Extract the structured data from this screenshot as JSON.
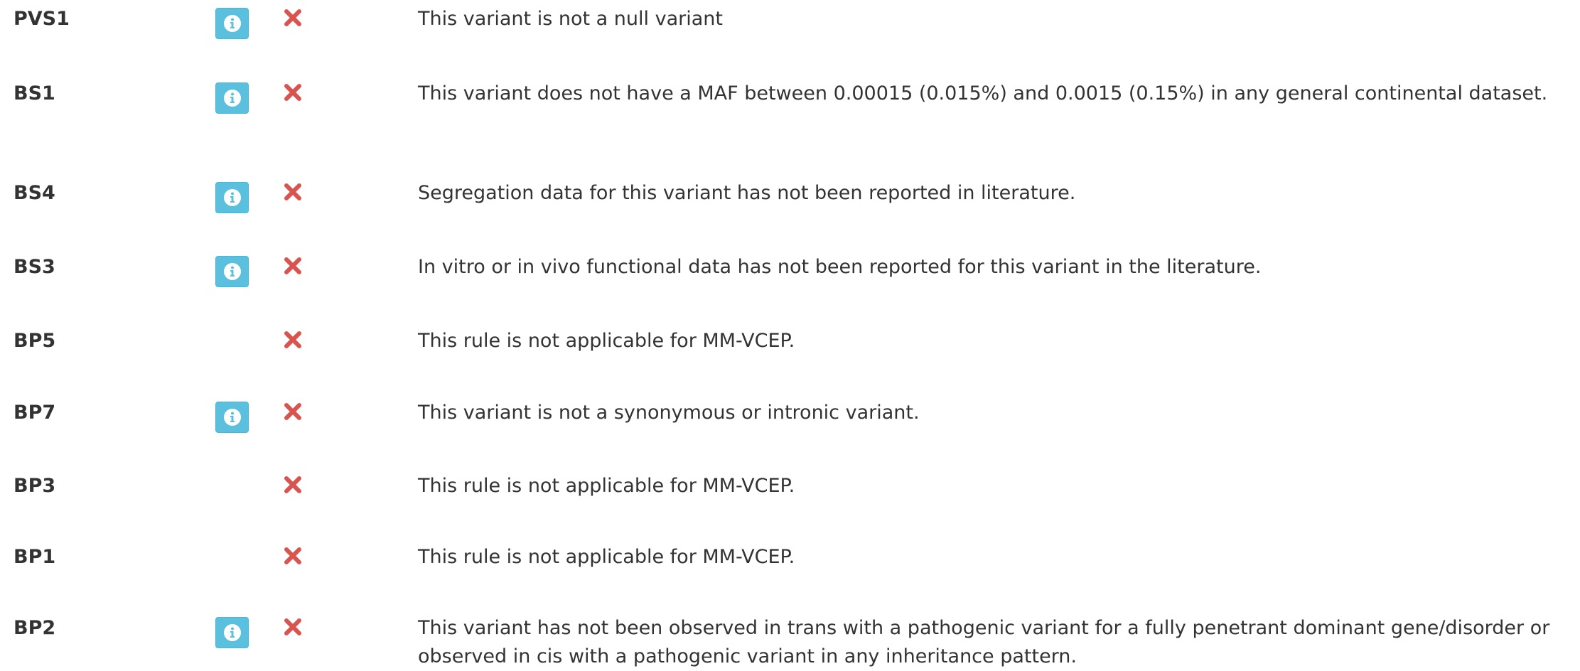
{
  "colors": {
    "text": "#333333",
    "info_button": "#5bc0de",
    "not_met_icon": "#d9534f"
  },
  "rules": [
    {
      "code": "PVS1",
      "has_info": true,
      "status_icon": "close-icon",
      "description": "This variant is not a null variant"
    },
    {
      "code": "BS1",
      "has_info": true,
      "status_icon": "close-icon",
      "description": "This variant does not have a MAF between 0.00015 (0.015%) and 0.0015 (0.15%) in any general continental dataset."
    },
    {
      "code": "BS4",
      "has_info": true,
      "status_icon": "close-icon",
      "description": "Segregation data for this variant has not been reported in literature."
    },
    {
      "code": "BS3",
      "has_info": true,
      "status_icon": "close-icon",
      "description": "In vitro or in vivo functional data has not been reported for this variant in the literature."
    },
    {
      "code": "BP5",
      "has_info": false,
      "status_icon": "close-icon",
      "description": "This rule is not applicable for MM-VCEP."
    },
    {
      "code": "BP7",
      "has_info": true,
      "status_icon": "close-icon",
      "description": "This variant is not a synonymous or intronic variant."
    },
    {
      "code": "BP3",
      "has_info": false,
      "status_icon": "close-icon",
      "description": "This rule is not applicable for MM-VCEP."
    },
    {
      "code": "BP1",
      "has_info": false,
      "status_icon": "close-icon",
      "description": "This rule is not applicable for MM-VCEP."
    },
    {
      "code": "BP2",
      "has_info": true,
      "status_icon": "close-icon",
      "description": "This variant has not been observed in trans with a pathogenic variant for a fully penetrant dominant gene/disorder or observed in cis with a pathogenic variant in any inheritance pattern."
    }
  ]
}
